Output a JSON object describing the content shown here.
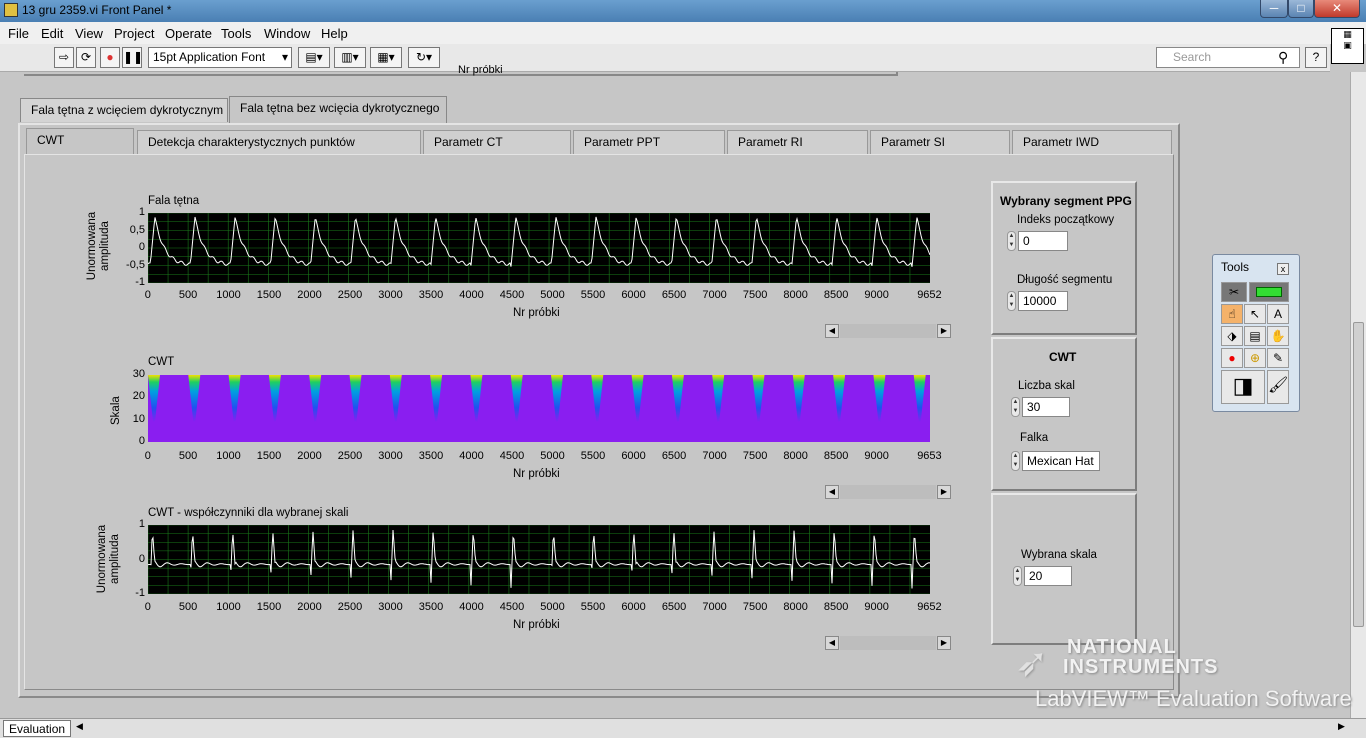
{
  "window": {
    "title": "13 gru 2359.vi Front Panel *",
    "min": "─",
    "max": "□",
    "close": "✕"
  },
  "menu": [
    "File",
    "Edit",
    "View",
    "Project",
    "Operate",
    "Tools",
    "Window",
    "Help"
  ],
  "toolbar": {
    "font": "15pt Application Font",
    "search_placeholder": "Search",
    "help": "?"
  },
  "top_strip_text": "Nr próbki",
  "tabs": [
    "Fala tętna z wcięciem dykrotycznym",
    "Fala tętna bez wcięcia dykrotycznego"
  ],
  "subtabs": [
    "CWT",
    "Detekcja charakterystycznych punktów",
    "Parametr CT",
    "Parametr PPT",
    "Parametr RI",
    "Parametr SI",
    "Parametr IWD"
  ],
  "graphs": [
    {
      "title": "Fala tętna",
      "ylabel": "Unormowana amplituda",
      "xlabel": "Nr próbki",
      "yticks": [
        "1",
        "0,5",
        "0",
        "-0,5",
        "-1"
      ],
      "xticks": [
        "0",
        "500",
        "1000",
        "1500",
        "2000",
        "2500",
        "3000",
        "3500",
        "4000",
        "4500",
        "5000",
        "5500",
        "6000",
        "6500",
        "7000",
        "7500",
        "8000",
        "8500",
        "9000",
        "9652"
      ]
    },
    {
      "title": "CWT",
      "ylabel": "Skala",
      "xlabel": "Nr próbki",
      "yticks": [
        "30",
        "20",
        "10",
        "0"
      ],
      "xticks": [
        "0",
        "500",
        "1000",
        "1500",
        "2000",
        "2500",
        "3000",
        "3500",
        "4000",
        "4500",
        "5000",
        "5500",
        "6000",
        "6500",
        "7000",
        "7500",
        "8000",
        "8500",
        "9000",
        "9653"
      ]
    },
    {
      "title": "CWT - współczynniki dla wybranej skali",
      "ylabel": "Unormowana amplituda",
      "xlabel": "Nr próbki",
      "yticks": [
        "1",
        "0",
        "-1"
      ],
      "xticks": [
        "0",
        "500",
        "1000",
        "1500",
        "2000",
        "2500",
        "3000",
        "3500",
        "4000",
        "4500",
        "5000",
        "5500",
        "6000",
        "6500",
        "7000",
        "7500",
        "8000",
        "8500",
        "9000",
        "9652"
      ]
    }
  ],
  "segment": {
    "title": "Wybrany segment PPG",
    "start_label": "Indeks początkowy",
    "start_value": "0",
    "length_label": "Długość segmentu",
    "length_value": "10000"
  },
  "cwt": {
    "title": "CWT",
    "scales_label": "Liczba skal",
    "scales_value": "30",
    "wavelet_label": "Falka",
    "wavelet_value": "Mexican Hat"
  },
  "scale": {
    "label": "Wybrana skala",
    "value": "20"
  },
  "tools": {
    "title": "Tools",
    "close": "x"
  },
  "status": {
    "label": "Evaluation"
  },
  "watermark": {
    "line1": "NATIONAL",
    "line2": "INSTRUMENTS",
    "line3": "LabVIEW™ Evaluation Software"
  },
  "colors": {
    "plot_bg": "#000000",
    "grid": "#1a7a1a",
    "trace": "#ffffff",
    "cwt_bg": "#8a1ef0"
  }
}
